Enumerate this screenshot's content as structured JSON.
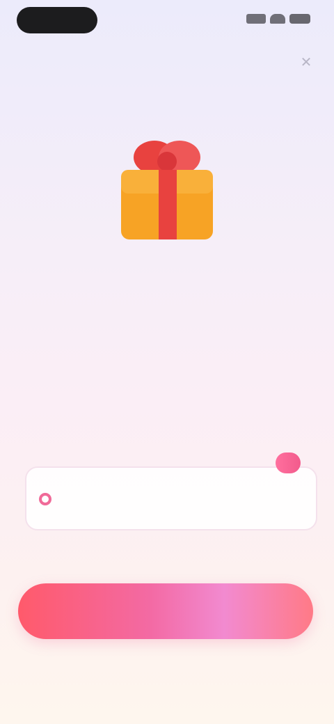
{
  "status_bar": {
    "time": "",
    "icons": [
      "signal-icon",
      "wifi-icon",
      "battery-icon"
    ]
  },
  "close": {
    "icon": "close-icon",
    "label": "✕"
  },
  "offer": {
    "icon": "gift-icon",
    "headline": "",
    "tag": "",
    "subtitle": ""
  },
  "plan": {
    "badge": "",
    "name": "",
    "trial": "",
    "price": "",
    "selected": true
  },
  "cta": {
    "label": ""
  },
  "footnote": "",
  "colors": {
    "accent": "#f06a98",
    "headline": "#e0437a",
    "tag": "#9b57d9",
    "gift_box": "#f7a325",
    "gift_ribbon": "#e8423f"
  }
}
